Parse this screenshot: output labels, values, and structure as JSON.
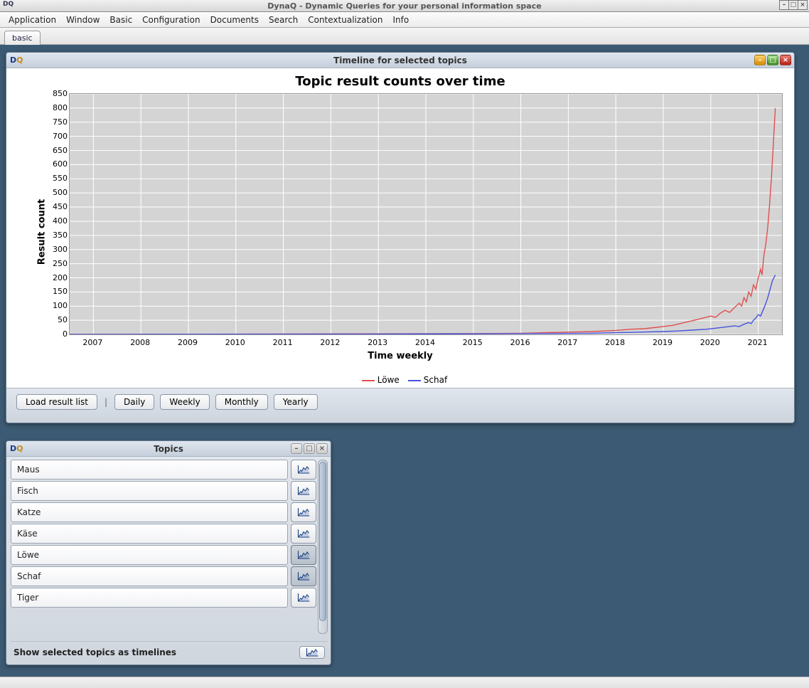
{
  "app": {
    "title": "DynaQ - Dynamic Queries for your personal information space",
    "logo": "DQ"
  },
  "menu": [
    "Application",
    "Window",
    "Basic",
    "Configuration",
    "Documents",
    "Search",
    "Contextualization",
    "Info"
  ],
  "tabstrip": {
    "tabs": [
      "basic"
    ]
  },
  "timeline_window": {
    "title": "Timeline for selected topics",
    "buttons": {
      "load": "Load result list",
      "daily": "Daily",
      "weekly": "Weekly",
      "monthly": "Monthly",
      "yearly": "Yearly"
    }
  },
  "topics_window": {
    "title": "Topics",
    "footer": "Show selected topics as timelines",
    "items": [
      {
        "label": "Maus",
        "active": false
      },
      {
        "label": "Fisch",
        "active": false
      },
      {
        "label": "Katze",
        "active": false
      },
      {
        "label": "Käse",
        "active": false
      },
      {
        "label": "Löwe",
        "active": true
      },
      {
        "label": "Schaf",
        "active": true
      },
      {
        "label": "Tiger",
        "active": false
      }
    ]
  },
  "chart_data": {
    "type": "line",
    "title": "Topic result counts over time",
    "xlabel": "Time weekly",
    "ylabel": "Result count",
    "ylim": [
      0,
      850
    ],
    "yticks": [
      0,
      50,
      100,
      150,
      200,
      250,
      300,
      350,
      400,
      450,
      500,
      550,
      600,
      650,
      700,
      750,
      800,
      850
    ],
    "xrange": [
      2006.5,
      2021.5
    ],
    "xticks": [
      2007,
      2008,
      2009,
      2010,
      2011,
      2012,
      2013,
      2014,
      2015,
      2016,
      2017,
      2018,
      2019,
      2020,
      2021
    ],
    "series": [
      {
        "name": "Löwe",
        "color": "#e05050",
        "points": [
          [
            2006.5,
            0
          ],
          [
            2010.0,
            1
          ],
          [
            2013.0,
            2
          ],
          [
            2015.0,
            3
          ],
          [
            2016.0,
            4
          ],
          [
            2016.5,
            6
          ],
          [
            2017.0,
            8
          ],
          [
            2017.5,
            10
          ],
          [
            2018.0,
            14
          ],
          [
            2018.3,
            18
          ],
          [
            2018.6,
            20
          ],
          [
            2018.8,
            24
          ],
          [
            2019.0,
            28
          ],
          [
            2019.2,
            32
          ],
          [
            2019.4,
            40
          ],
          [
            2019.6,
            48
          ],
          [
            2019.8,
            56
          ],
          [
            2020.0,
            65
          ],
          [
            2020.1,
            60
          ],
          [
            2020.2,
            75
          ],
          [
            2020.3,
            85
          ],
          [
            2020.4,
            78
          ],
          [
            2020.5,
            95
          ],
          [
            2020.6,
            110
          ],
          [
            2020.65,
            100
          ],
          [
            2020.7,
            130
          ],
          [
            2020.75,
            115
          ],
          [
            2020.8,
            150
          ],
          [
            2020.85,
            135
          ],
          [
            2020.9,
            175
          ],
          [
            2020.95,
            160
          ],
          [
            2021.0,
            200
          ],
          [
            2021.05,
            230
          ],
          [
            2021.08,
            210
          ],
          [
            2021.12,
            280
          ],
          [
            2021.16,
            320
          ],
          [
            2021.2,
            380
          ],
          [
            2021.24,
            460
          ],
          [
            2021.28,
            560
          ],
          [
            2021.32,
            680
          ],
          [
            2021.36,
            800
          ]
        ]
      },
      {
        "name": "Schaf",
        "color": "#4455dd",
        "points": [
          [
            2006.5,
            0
          ],
          [
            2012.0,
            1
          ],
          [
            2015.0,
            2
          ],
          [
            2016.5,
            3
          ],
          [
            2017.5,
            4
          ],
          [
            2018.0,
            6
          ],
          [
            2018.5,
            8
          ],
          [
            2019.0,
            10
          ],
          [
            2019.3,
            12
          ],
          [
            2019.6,
            15
          ],
          [
            2019.9,
            18
          ],
          [
            2020.1,
            22
          ],
          [
            2020.3,
            26
          ],
          [
            2020.5,
            30
          ],
          [
            2020.6,
            28
          ],
          [
            2020.7,
            36
          ],
          [
            2020.8,
            42
          ],
          [
            2020.85,
            38
          ],
          [
            2020.9,
            50
          ],
          [
            2020.95,
            58
          ],
          [
            2021.0,
            70
          ],
          [
            2021.05,
            65
          ],
          [
            2021.1,
            85
          ],
          [
            2021.15,
            105
          ],
          [
            2021.2,
            130
          ],
          [
            2021.25,
            160
          ],
          [
            2021.3,
            190
          ],
          [
            2021.36,
            210
          ]
        ]
      }
    ]
  }
}
